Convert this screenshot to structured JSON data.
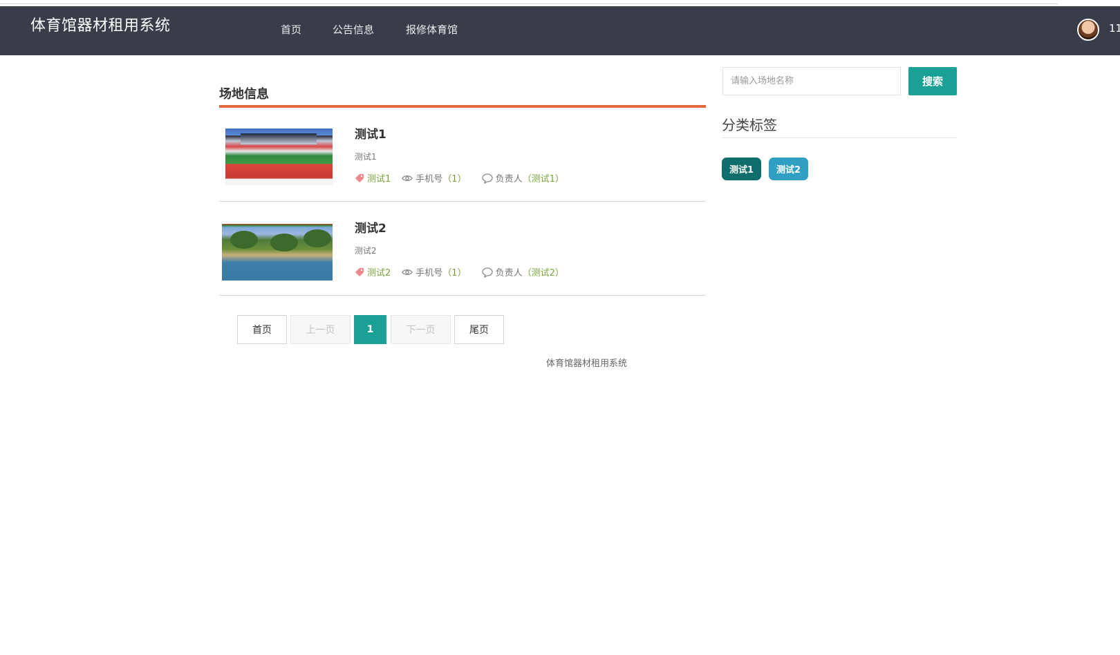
{
  "colors": {
    "navbar_bg": "#393d49",
    "accent_teal": "#1aa094",
    "title_underline": "#e0693f",
    "tag_dark": "#0e6e6b",
    "tag_light": "#2f9fc3",
    "meta_green": "#7aa33a"
  },
  "header": {
    "brand": "体育馆器材租用系统",
    "nav": [
      "首页",
      "公告信息",
      "报修体育馆"
    ],
    "username": "11"
  },
  "main": {
    "section_title": "场地信息",
    "items": [
      {
        "title": "测试1",
        "desc": "测试1",
        "tag": "测试1",
        "phone_label": "手机号",
        "phone_value": "（1）",
        "owner_label": "负责人",
        "owner_value": "（测试1）"
      },
      {
        "title": "测试2",
        "desc": "测试2",
        "tag": "测试2",
        "phone_label": "手机号",
        "phone_value": "（1）",
        "owner_label": "负责人",
        "owner_value": "（测试2）"
      }
    ],
    "pagination": {
      "first": "首页",
      "prev": "上一页",
      "current": "1",
      "next": "下一页",
      "last": "尾页"
    }
  },
  "sidebar": {
    "search_placeholder": "请输入场地名称",
    "search_button": "搜索",
    "categories_title": "分类标签",
    "tags": [
      "测试1",
      "测试2"
    ]
  },
  "footer": {
    "text": "体育馆器材租用系统"
  },
  "icons": {
    "tag": "tag-icon",
    "eye": "eye-icon",
    "comment": "comment-icon"
  }
}
